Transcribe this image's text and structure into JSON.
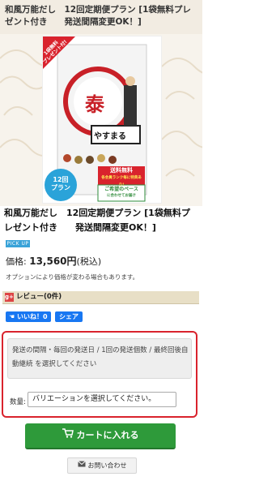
{
  "header": {
    "title": "和風万能だし　12回定期便プラン [1袋無料プレゼント付き　　発送間隔変更OK！]"
  },
  "product_image": {
    "ribbon_line1": "1袋無料",
    "ribbon_line2": "プレゼント付!",
    "brand_kanji": "泰",
    "brand_name": "やすまる",
    "plan_number": "12回",
    "plan_word": "プラン",
    "free_shipping": "送料無料",
    "rank_note": "各会員ランク毎に特典あり!",
    "pace_line1": "ご希望のペース",
    "pace_line2": "に合わせてお届け",
    "colors": {
      "plan_circle": "#2aa3d9",
      "free_ship_bg": "#d9232d",
      "pace_green": "#2e8b3a",
      "ribbon_red": "#d9232d"
    }
  },
  "product": {
    "title": "和風万能だし　12回定期便プラン [1袋無料プレゼント付き　　発送間隔変更OK！]",
    "badge": "PICK UP",
    "price_label": "価格:",
    "price_value": "13,560円",
    "price_tax": "(税込)",
    "price_note": "オプションにより価格が変わる場合もあります。"
  },
  "review": {
    "label": "レビュー(0件)",
    "icon_text": "g+"
  },
  "social": {
    "like": "いいね！0",
    "share": "シェア"
  },
  "options": {
    "select_text": "発送の間隔・毎回の発送日 / 1回の発送個数 / 最終回後自動継続 を選択してください",
    "qty_label": "数量:",
    "variation_text": "バリエーションを選択してください。"
  },
  "actions": {
    "cart": "カートに入れる",
    "inquiry": "お問い合わせ"
  }
}
